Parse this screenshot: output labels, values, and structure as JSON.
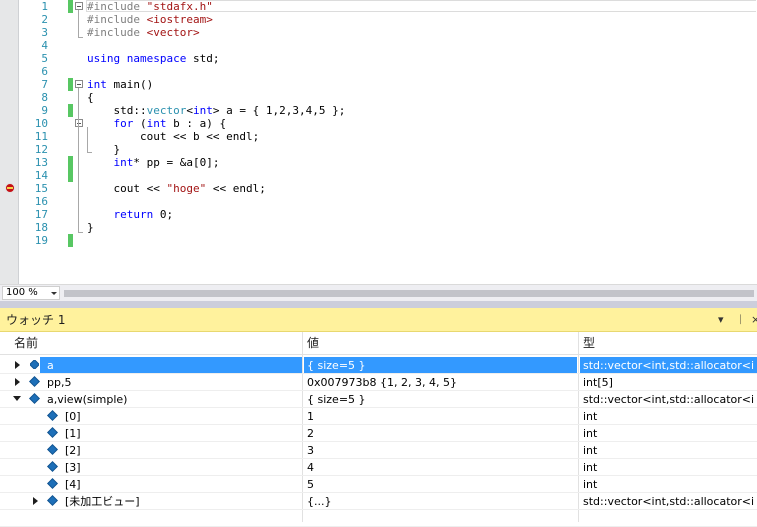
{
  "editor": {
    "lines": [
      {
        "n": "1",
        "code": "#include \"stdafx.h\"",
        "changed": true,
        "fold": true
      },
      {
        "n": "2",
        "code": "#include <iostream>",
        "changed": false,
        "fold": false
      },
      {
        "n": "3",
        "code": "#include <vector>",
        "changed": false,
        "fold": false
      },
      {
        "n": "4",
        "code": "",
        "changed": false,
        "fold": false
      },
      {
        "n": "5",
        "code": "using namespace std;",
        "changed": false,
        "fold": false
      },
      {
        "n": "6",
        "code": "",
        "changed": false,
        "fold": false
      },
      {
        "n": "7",
        "code": "int main()",
        "changed": true,
        "fold": true
      },
      {
        "n": "8",
        "code": "{",
        "changed": false,
        "fold": false
      },
      {
        "n": "9",
        "code": "    std::vector<int> a = { 1,2,3,4,5 };",
        "changed": true,
        "fold": false
      },
      {
        "n": "10",
        "code": "    for (int b : a) {",
        "changed": false,
        "fold": true
      },
      {
        "n": "11",
        "code": "        cout << b << endl;",
        "changed": false,
        "fold": false
      },
      {
        "n": "12",
        "code": "    }",
        "changed": false,
        "fold": false
      },
      {
        "n": "13",
        "code": "    int* pp = &a[0];",
        "changed": true,
        "fold": false
      },
      {
        "n": "14",
        "code": "",
        "changed": true,
        "fold": false
      },
      {
        "n": "15",
        "code": "    cout << \"hoge\" << endl;",
        "changed": false,
        "fold": false,
        "breakpoint": true
      },
      {
        "n": "16",
        "code": "",
        "changed": false,
        "fold": false
      },
      {
        "n": "17",
        "code": "    return 0;",
        "changed": false,
        "fold": false
      },
      {
        "n": "18",
        "code": "}",
        "changed": false,
        "fold": false
      },
      {
        "n": "19",
        "code": "",
        "changed": true,
        "fold": false
      }
    ],
    "zoom": "100 %"
  },
  "watch": {
    "title": "ウォッチ 1",
    "tool_dropdown": "▾",
    "tool_pin": "ᛁ",
    "tool_close": "×",
    "columns": {
      "name": "名前",
      "value": "値",
      "type": "型"
    },
    "rows": [
      {
        "name": "a",
        "value": "{ size=5 }",
        "type": "std::vector<int,std::allocator<int",
        "expander": "collapsed",
        "selected": true
      },
      {
        "name": "pp,5",
        "value": "0x007973b8 {1, 2, 3, 4, 5}",
        "type": "int[5]",
        "expander": "collapsed"
      },
      {
        "name": "a,view(simple)",
        "value": "{ size=5 }",
        "type": "std::vector<int,std::allocator<int",
        "expander": "expanded"
      },
      {
        "name": "[0]",
        "value": "1",
        "type": "int",
        "expander": "none",
        "child": true
      },
      {
        "name": "[1]",
        "value": "2",
        "type": "int",
        "expander": "none",
        "child": true
      },
      {
        "name": "[2]",
        "value": "3",
        "type": "int",
        "expander": "none",
        "child": true
      },
      {
        "name": "[3]",
        "value": "4",
        "type": "int",
        "expander": "none",
        "child": true
      },
      {
        "name": "[4]",
        "value": "5",
        "type": "int",
        "expander": "none",
        "child": true
      },
      {
        "name": "[未加工ビュー]",
        "value": "{...}",
        "type": "std::vector<int,std::allocator<int",
        "expander": "collapsed",
        "child": true
      }
    ]
  },
  "colors": {
    "keyword": "#0000ff",
    "type": "#2b91af",
    "string": "#a31515",
    "preproc": "#808080",
    "selection": "#3399ff",
    "watch_title_bg": "#fff29d",
    "change_bar": "#58c763",
    "breakpoint": "#c50f15"
  }
}
